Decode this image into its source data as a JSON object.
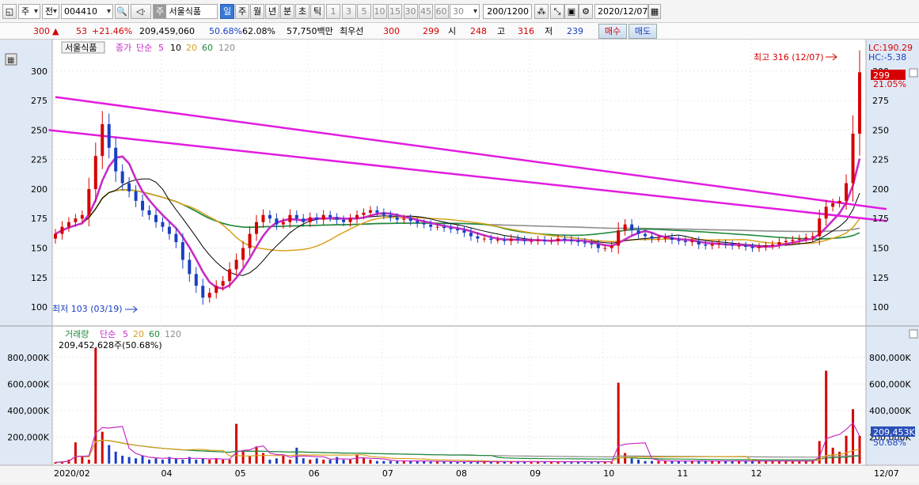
{
  "toolbar": {
    "type_select": "주",
    "market_select": "전",
    "code": "004410",
    "stock_name_badge": "주",
    "stock_name": "서울식품",
    "periods": [
      "일",
      "주",
      "월",
      "년",
      "분",
      "초",
      "틱"
    ],
    "active_period": "일",
    "intervals": [
      "1",
      "3",
      "5",
      "10",
      "15",
      "30",
      "45",
      "60"
    ],
    "interval_value": "30",
    "count": "200/1200",
    "date": "2020/12/07"
  },
  "quote": {
    "price": "300",
    "change": "53",
    "change_pct": "+21.46%",
    "volume": "209,459,060",
    "vol_ratio": "50.68%",
    "turnover": "62.08%",
    "amount": "57,750백만",
    "best_label": "최우선",
    "best_ask": "300",
    "best_bid": "299",
    "open_label": "시",
    "open": "248",
    "high_label": "고",
    "high": "316",
    "low_label": "저",
    "low": "239",
    "buy_button": "매수",
    "sell_button": "매도"
  },
  "colors": {
    "up": "#d60000",
    "down": "#1a3fc4",
    "trendline": "#e21be0",
    "ma5": "#c72cc7",
    "ma10": "#000000",
    "ma20": "#d9a21b",
    "ma60": "#1e8a3a",
    "ma120": "#8c8c8c"
  },
  "chart_data": [
    {
      "type": "candlestick",
      "legend_stock": "서울식품",
      "legend_price": "종가",
      "legend_ma_label": "단순",
      "legend_ma": [
        "5",
        "10",
        "20",
        "60",
        "120"
      ],
      "yticks": [
        100,
        125,
        150,
        175,
        200,
        225,
        250,
        275,
        300
      ],
      "ylim": [
        92,
        320
      ],
      "xticks": [
        "2020/02",
        "04",
        "05",
        "06",
        "07",
        "08",
        "09",
        "10",
        "11",
        "12"
      ],
      "right_axis_end_label": "12/07",
      "high_annotation": "최고 316 (12/07)",
      "low_annotation": "최저 103 (03/19)",
      "lc_label": "LC:190.29",
      "hc_label": "HC:-5.38",
      "last_price_tag": "299",
      "last_pct_tag": "21.05%",
      "series_close": [
        162,
        168,
        172,
        175,
        178,
        200,
        228,
        255,
        235,
        215,
        205,
        198,
        190,
        182,
        178,
        172,
        168,
        162,
        155,
        140,
        128,
        118,
        108,
        112,
        118,
        122,
        132,
        140,
        150,
        162,
        172,
        178,
        175,
        170,
        172,
        178,
        175,
        172,
        176,
        174,
        178,
        176,
        174,
        172,
        175,
        178,
        180,
        182,
        180,
        178,
        176,
        174,
        175,
        173,
        171,
        170,
        168,
        168,
        167,
        166,
        165,
        163,
        160,
        158,
        158,
        157,
        157,
        156,
        158,
        157,
        156,
        156,
        157,
        156,
        156,
        158,
        157,
        156,
        155,
        154,
        153,
        150,
        150,
        152,
        165,
        170,
        165,
        162,
        160,
        158,
        158,
        159,
        157,
        156,
        155,
        156,
        153,
        152,
        153,
        154,
        153,
        152,
        152,
        151,
        150,
        151,
        152,
        153,
        155,
        156,
        157,
        158,
        159,
        160,
        175,
        185,
        188,
        190,
        205,
        247,
        299
      ]
    },
    {
      "type": "bar",
      "legend_title": "거래량",
      "legend_ma_label": "단순",
      "legend_ma": [
        "5",
        "20",
        "60",
        "120"
      ],
      "volume_annotation": "209,452,628주(50.68%)",
      "yticks": [
        "200,000K",
        "400,000K",
        "600,000K",
        "800,000K"
      ],
      "ylim": [
        0,
        900000
      ],
      "last_volume_tag": "209,453K",
      "last_volume_pct": "50.68%",
      "series_volume_k": [
        10000,
        15000,
        30000,
        160000,
        60000,
        30000,
        870000,
        240000,
        140000,
        90000,
        60000,
        50000,
        40000,
        60000,
        30000,
        40000,
        30000,
        50000,
        40000,
        30000,
        50000,
        30000,
        40000,
        30000,
        40000,
        30000,
        30000,
        300000,
        100000,
        60000,
        130000,
        80000,
        30000,
        40000,
        60000,
        30000,
        120000,
        40000,
        30000,
        40000,
        30000,
        30000,
        50000,
        30000,
        30000,
        70000,
        40000,
        30000,
        20000,
        20000,
        20000,
        20000,
        20000,
        20000,
        20000,
        20000,
        15000,
        15000,
        15000,
        15000,
        15000,
        15000,
        15000,
        15000,
        15000,
        15000,
        15000,
        15000,
        15000,
        15000,
        15000,
        15000,
        15000,
        15000,
        15000,
        15000,
        15000,
        15000,
        15000,
        15000,
        15000,
        15000,
        15000,
        10000,
        610000,
        80000,
        40000,
        30000,
        20000,
        20000,
        20000,
        20000,
        20000,
        20000,
        20000,
        20000,
        20000,
        20000,
        20000,
        20000,
        20000,
        20000,
        20000,
        20000,
        20000,
        20000,
        20000,
        20000,
        20000,
        20000,
        20000,
        20000,
        20000,
        20000,
        170000,
        700000,
        120000,
        90000,
        210000,
        410000,
        209453
      ]
    }
  ]
}
